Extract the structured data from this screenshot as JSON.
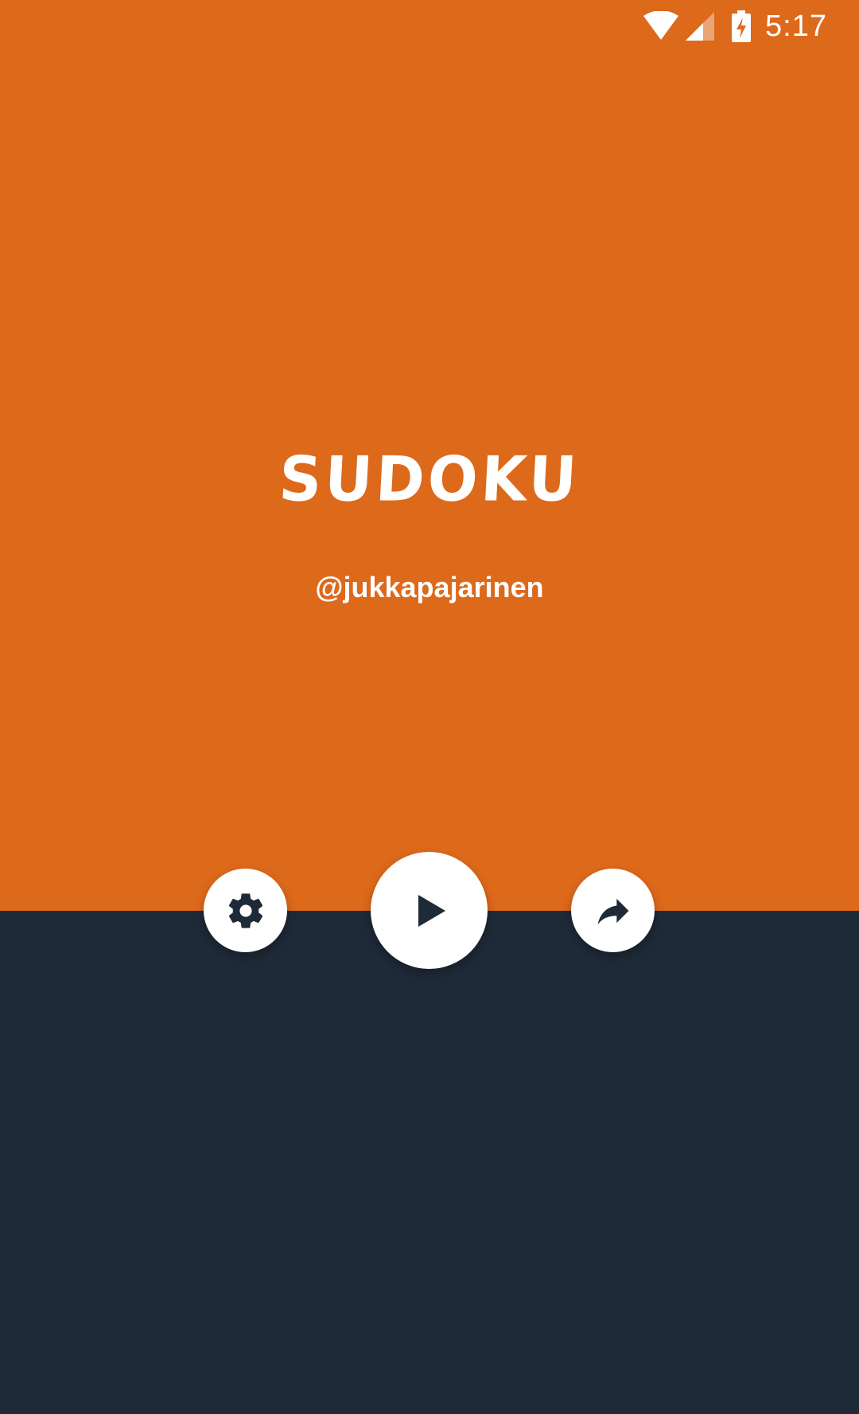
{
  "status_bar": {
    "time": "5:17",
    "icons": [
      "wifi-icon",
      "cell-signal-icon",
      "battery-charging-icon"
    ]
  },
  "app": {
    "title": "SUDOKU",
    "author": "@jukkapajarinen"
  },
  "buttons": {
    "settings_icon": "gear-icon",
    "play_icon": "play-icon",
    "share_icon": "share-arrow-icon"
  },
  "colors": {
    "primary": "#dd691b",
    "secondary": "#1f2a38",
    "button_bg": "#ffffff",
    "icon": "#1f2a38"
  }
}
